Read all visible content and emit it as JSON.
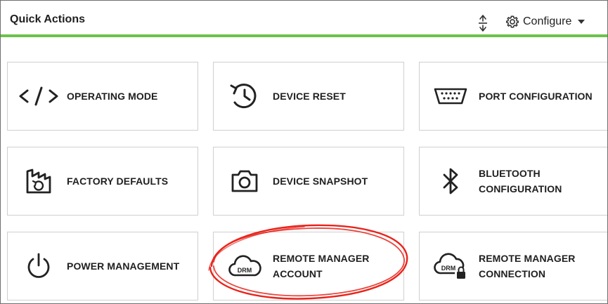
{
  "header": {
    "title": "Quick Actions",
    "configure_label": "Configure",
    "accent_color": "#6cc24a"
  },
  "tiles": [
    {
      "icon": "code-icon",
      "label": "OPERATING MODE"
    },
    {
      "icon": "history-icon",
      "label": "DEVICE RESET"
    },
    {
      "icon": "serial-port-icon",
      "label": "PORT CONFIGURATION"
    },
    {
      "icon": "factory-defaults-icon",
      "label": "FACTORY DEFAULTS"
    },
    {
      "icon": "camera-icon",
      "label": "DEVICE SNAPSHOT"
    },
    {
      "icon": "bluetooth-icon",
      "label_line1": "BLUETOOTH",
      "label_line2": "CONFIGURATION"
    },
    {
      "icon": "power-icon",
      "label": "POWER MANAGEMENT"
    },
    {
      "icon": "drm-cloud-icon",
      "icon_text": "DRM",
      "label_line1": "REMOTE MANAGER",
      "label_line2": "ACCOUNT"
    },
    {
      "icon": "drm-cloud-lock-icon",
      "icon_text": "DRM",
      "label_line1": "REMOTE MANAGER",
      "label_line2": "CONNECTION"
    }
  ],
  "annotation": {
    "type": "hand-drawn-circle",
    "color": "#e8241c",
    "target": "REMOTE MANAGER ACCOUNT"
  }
}
